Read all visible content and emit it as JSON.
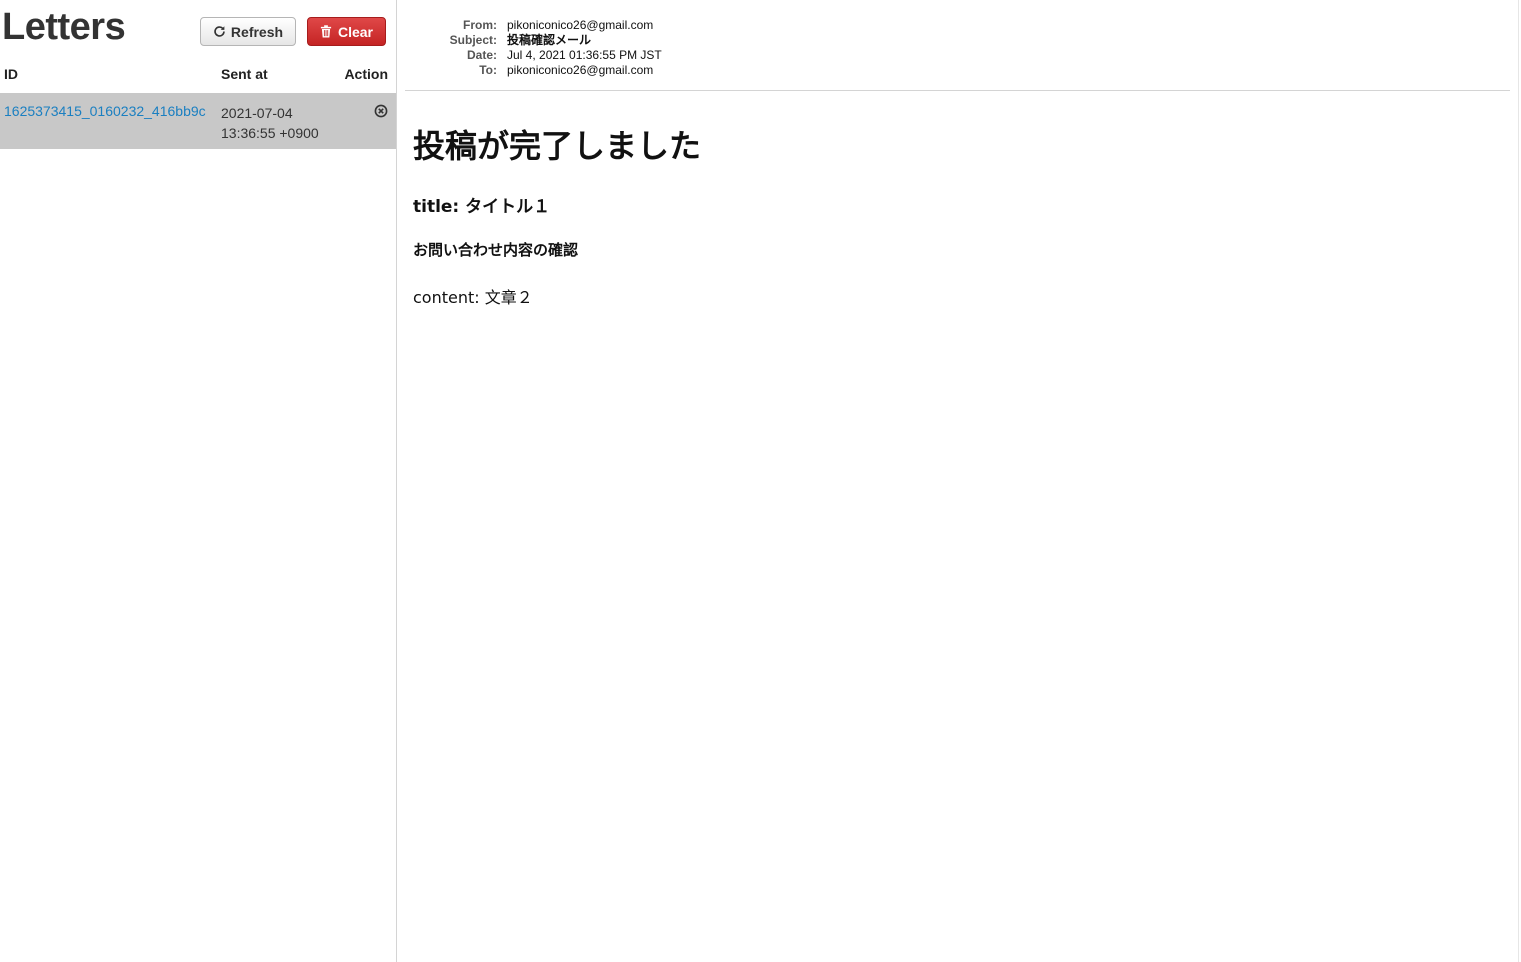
{
  "sidebar": {
    "title": "Letters",
    "refresh_label": "Refresh",
    "clear_label": "Clear",
    "columns": {
      "id": "ID",
      "sent_at": "Sent at",
      "action": "Action"
    },
    "letters": [
      {
        "id": "1625373415_0160232_416bb9c",
        "sent_date": "2021-07-04",
        "sent_time": "13:36:55 +0900"
      }
    ]
  },
  "mail": {
    "headers": {
      "from_label": "From:",
      "from": "pikoniconico26@gmail.com",
      "subject_label": "Subject:",
      "subject": "投稿確認メール",
      "date_label": "Date:",
      "date": "Jul 4, 2021 01:36:55 PM JST",
      "to_label": "To:",
      "to": "pikoniconico26@gmail.com"
    },
    "body": {
      "heading": "投稿が完了しました",
      "title_line": "title: タイトル１",
      "subheading": "お問い合わせ内容の確認",
      "content_line": "content: 文章２"
    }
  },
  "colors": {
    "selected_row": "#c8c8c8",
    "link": "#1a7fc1",
    "danger": "#c42424"
  },
  "icons": {
    "refresh": "refresh-icon",
    "clear": "trash-icon",
    "delete": "close-circle-icon"
  }
}
